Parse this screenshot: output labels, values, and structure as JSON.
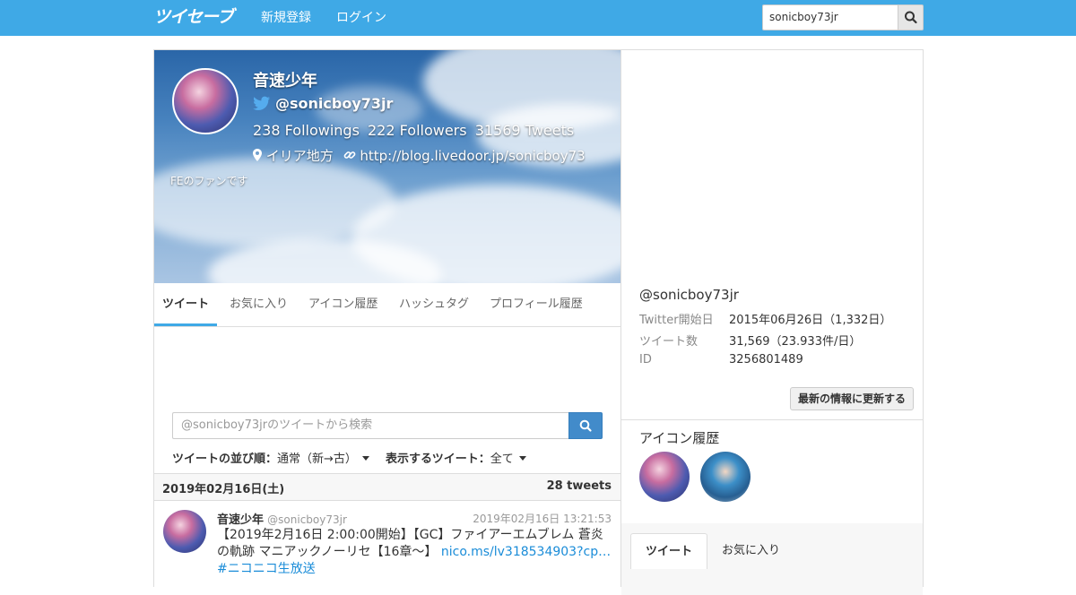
{
  "navbar": {
    "brand": "ツイセーブ",
    "links": [
      "新規登録",
      "ログイン"
    ],
    "search_value": "sonicboy73jr",
    "search_icon": "search-icon"
  },
  "profile": {
    "name": "音速少年",
    "handle": "@sonicboy73jr",
    "followings": "238",
    "followings_label": "Followings",
    "followers": "222",
    "followers_label": "Followers",
    "tweets": "31569",
    "tweets_label": "Tweets",
    "location": "イリア地方",
    "url": "http://blog.livedoor.jp/sonicboy73",
    "bio": "FEのファンです"
  },
  "tabs": [
    "ツイート",
    "お気に入り",
    "アイコン履歴",
    "ハッシュタグ",
    "プロフィール履歴"
  ],
  "tweet_search": {
    "placeholder": "@sonicboy73jrのツイートから検索"
  },
  "sort": {
    "order_label": "ツイートの並び順：",
    "order_value": "通常（新→古）",
    "filter_label": "表示するツイート：",
    "filter_value": "全て"
  },
  "date_group": {
    "date": "2019年02月16日(土)",
    "count": "28 tweets"
  },
  "tweet": {
    "name": "音速少年",
    "handle": "@sonicboy73jr",
    "time": "2019年02月16日 13:21:53",
    "text": "【2019年2月16日 2:00:00開始】【GC】ファイアーエムブレム 蒼炎の軌跡 マニアックノーリセ【16章～】 ",
    "link": "nico.ms/lv318534903?cp…",
    "hashtag": "#ニ",
    "hashtag_cont": "コニコ生放送"
  },
  "account_info": {
    "handle": "@sonicboy73jr",
    "rows": [
      {
        "label": "Twitter開始日",
        "value": "2015年06月26日（1,332日）"
      },
      {
        "label": "ツイート数",
        "value": "31,569（23.933件/日）"
      },
      {
        "label": "ID",
        "value": "3256801489"
      }
    ],
    "update_button": "最新の情報に更新する"
  },
  "icon_history": {
    "title": "アイコン履歴"
  },
  "right_tabs": [
    "ツイート",
    "お気に入り"
  ],
  "colors": {
    "navbar": "#3fa9e6",
    "primary": "#428bca",
    "link": "#1a8cd8"
  }
}
